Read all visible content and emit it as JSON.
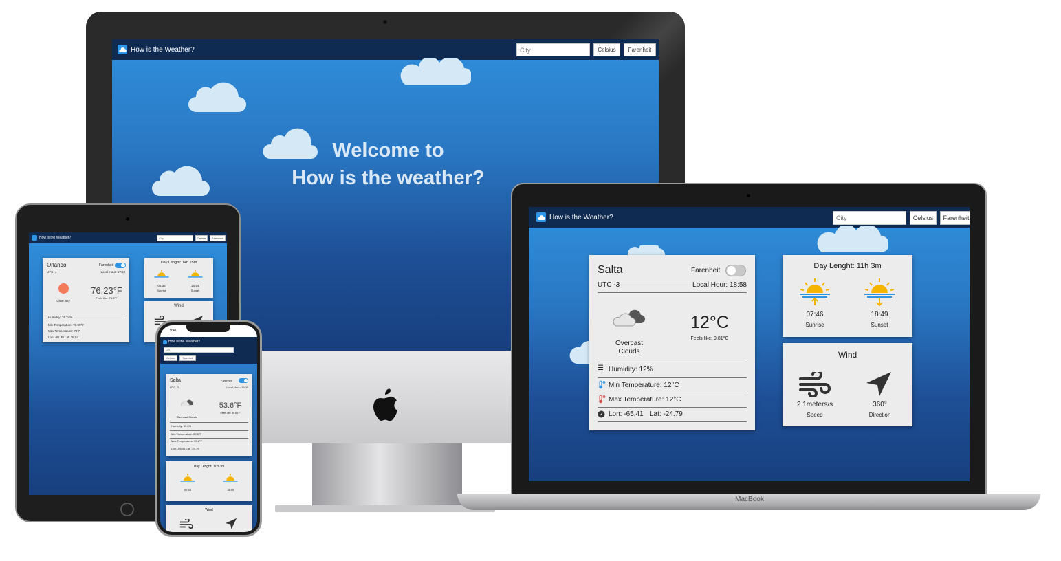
{
  "app": {
    "title": "How is the Weather?",
    "city_placeholder": "City",
    "celsius_label": "Celsius",
    "farenheit_label": "Farenheit"
  },
  "desktop": {
    "welcome_line1": "Welcome to",
    "welcome_line2": "How is the weather?"
  },
  "laptop": {
    "brand": "MacBook",
    "city": "Salta",
    "toggle_label": "Farenheit",
    "toggle_on": false,
    "utc": "UTC -3",
    "local_hour": "Local Hour: 18:58",
    "condition": "Overcast Clouds",
    "temperature": "12°C",
    "feels_like": "Feels like: 9.81°C",
    "humidity": "Humidity: 12%",
    "min_temp": "Min Temperature: 12°C",
    "max_temp": "Max Temperature: 12°C",
    "lon": "Lon: -65.41",
    "lat": "Lat: -24.79",
    "day_length": "Day Lenght: 11h 3m",
    "sunrise_time": "07:46",
    "sunrise_label": "Sunrise",
    "sunset_time": "18:49",
    "sunset_label": "Sunset",
    "wind_title": "Wind",
    "wind_speed": "2.1meters/s",
    "speed_label": "Speed",
    "wind_direction": "360°",
    "direction_label": "Direction"
  },
  "tablet": {
    "city": "Orlando",
    "toggle_label": "Farenheit",
    "toggle_on": true,
    "utc": "UTC -4",
    "local_hour": "Local Hour: 17:50",
    "condition": "Clear Sky",
    "temperature": "76.23°F",
    "feels_like": "Feels like: 76.3°F",
    "humidity": "Humidity: 76.24%",
    "min_temp": "Min Temperature: 73.99°F",
    "max_temp": "Max Temperature: 79°F",
    "lon_lat": "Lon: -81.38  Lat: 28.54",
    "day_length": "Day Lenght: 14h 25m",
    "sunrise_time": "06:36",
    "sunrise_label": "Sunrise",
    "sunset_time": "20:04",
    "sunset_label": "Sunset",
    "wind_title": "Wind"
  },
  "phone": {
    "status_time": "9:41",
    "city": "Salta",
    "toggle_label": "Farenheit",
    "toggle_on": true,
    "utc": "UTC -3",
    "local_hour": "Local Hour: 19:00",
    "condition": "Overcast Clouds",
    "temperature": "53.6°F",
    "feels_like": "Feels like: 49.66°F",
    "humidity": "Humidity: 53.6%",
    "min_temp": "Min Temperature: 53.6°F",
    "max_temp": "Max Temperature: 53.6°F",
    "lon_lat": "Lon: -65.41  Lat: -24.79",
    "day_length": "Day Lenght: 11h 3m",
    "sunrise_time": "07:46",
    "sunset_time": "18:49",
    "wind_title": "Wind"
  },
  "colors": {
    "nav": "#0f2b52",
    "sky_top": "#3090dc",
    "sky_bottom": "#173f7e",
    "card": "#ececec",
    "toggle_on": "#2f95e6",
    "sun": "#f5b400"
  }
}
